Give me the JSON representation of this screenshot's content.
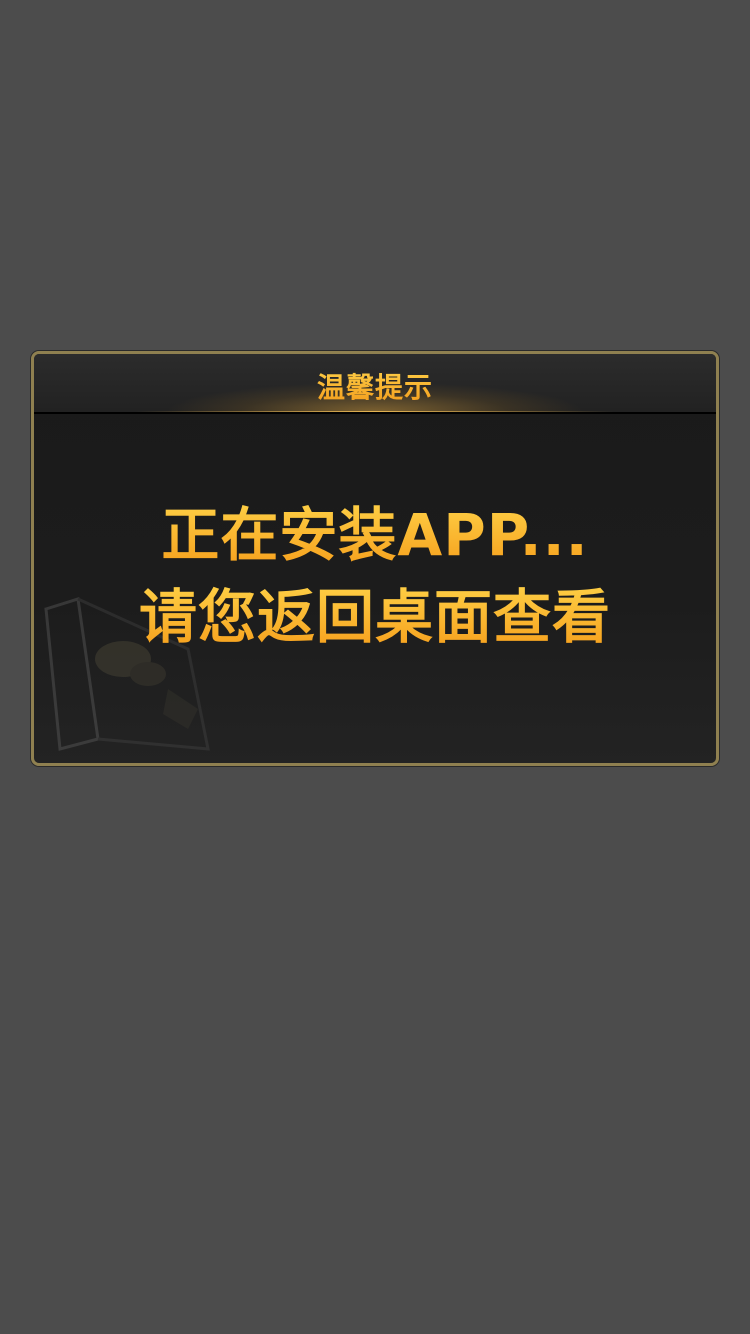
{
  "dialog": {
    "title": "温馨提示",
    "message_line1": "正在安装APP...",
    "message_line2": "请您返回桌面查看"
  },
  "colors": {
    "background": "#4c4c4c",
    "dialog_bg": "#1c1c1c",
    "border": "#8f8050",
    "text_gold_top": "#ffd54a",
    "text_gold_bottom": "#f59a18"
  },
  "icons": {
    "decor": "card-decoration-icon"
  }
}
